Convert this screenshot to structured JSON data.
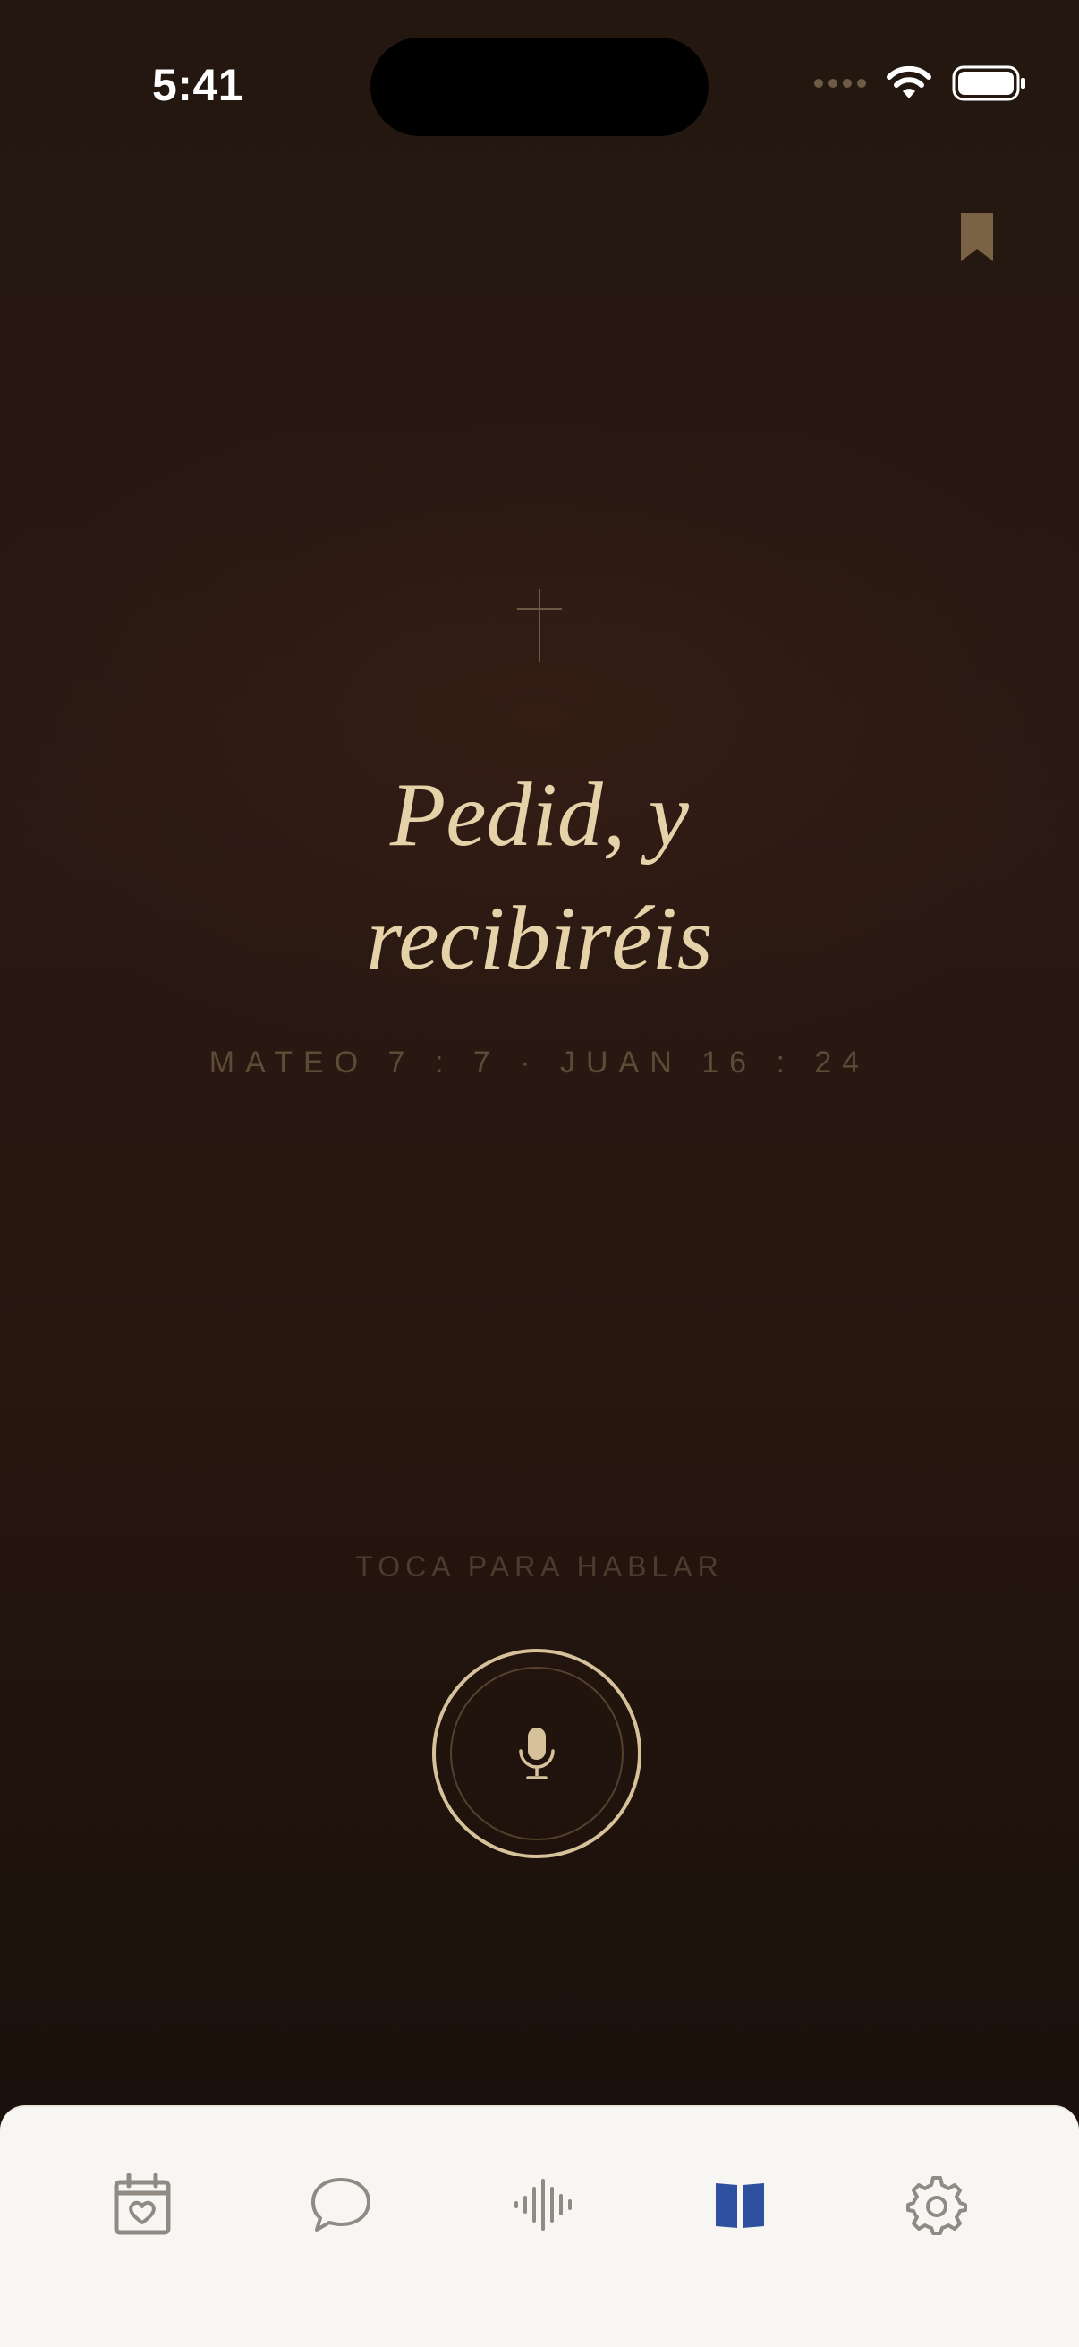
{
  "status_bar": {
    "time": "5:41"
  },
  "header": {
    "bookmark_icon": "bookmark-icon"
  },
  "verse": {
    "icon": "cross-icon",
    "title_line1": "Pedid, y",
    "title_line2": "recibiréis",
    "references": "MATEO 7 : 7  ·  JUAN 16 : 24"
  },
  "voice": {
    "prompt": "TOCA PARA HABLAR",
    "mic_icon": "microphone-icon"
  },
  "tabbar": {
    "active_index": 3,
    "items": [
      {
        "icon": "calendar-heart-icon"
      },
      {
        "icon": "chat-bubble-icon"
      },
      {
        "icon": "audio-waveform-icon"
      },
      {
        "icon": "book-icon"
      },
      {
        "icon": "gear-icon"
      }
    ]
  },
  "colors": {
    "background": "#23170f",
    "accent_gold": "#e6d2a9",
    "muted_text": "#5d4a37",
    "tab_active": "#2f4f9f",
    "tab_inactive": "#8f8b84",
    "tabbar_bg": "#f7f6f2"
  }
}
